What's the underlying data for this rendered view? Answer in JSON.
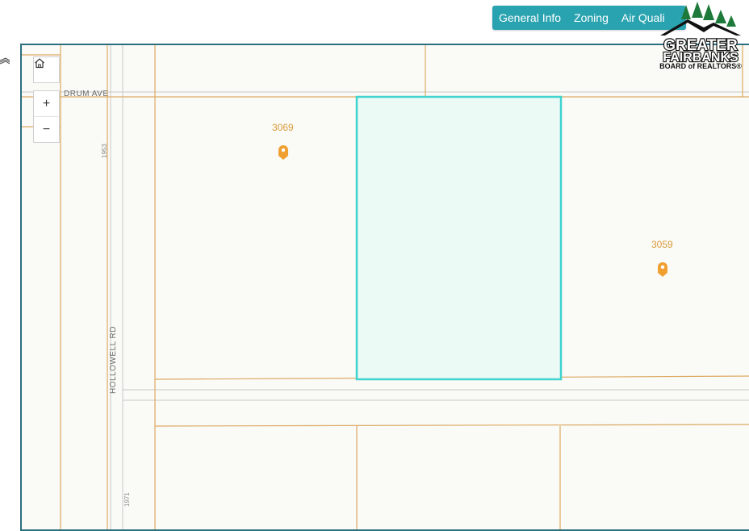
{
  "tabs": [
    {
      "label": "General Info"
    },
    {
      "label": "Zoning"
    },
    {
      "label": "Air Quali"
    }
  ],
  "map": {
    "streets": {
      "drum": "DRUM AVE",
      "hollowell": "HOLLOWELL  RD"
    },
    "addresses": {
      "upper": "1953",
      "lower": "1971"
    },
    "lots": [
      {
        "label": "3069"
      },
      {
        "label": "3059"
      }
    ],
    "controls": {
      "zoom_in": "+",
      "zoom_out": "−"
    },
    "colors": {
      "parcel_line": "#dcaa63",
      "selected_outline": "#3fd4cf",
      "selected_fill": "#ebfaf4",
      "pin": "#f0a030"
    }
  },
  "logo": {
    "line1": "GREATER",
    "line2": "FAIRBANKS",
    "line3": "BOARD of REALTORS®"
  }
}
